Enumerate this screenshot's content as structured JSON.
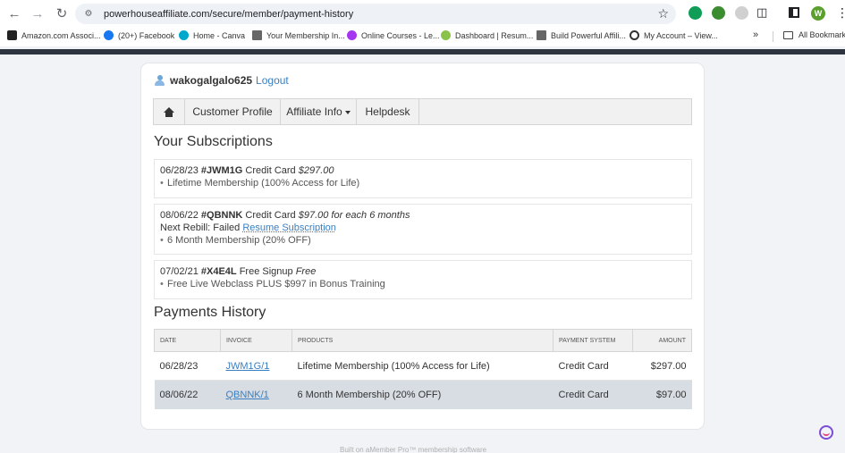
{
  "browser": {
    "url": "powerhouseaffiliate.com/secure/member/payment-history",
    "profile_initial": "W",
    "bookmarks": [
      {
        "label": "Amazon.com Associ...",
        "icon": "amazon-icon",
        "color": "#222222"
      },
      {
        "label": "(20+) Facebook",
        "icon": "facebook-icon",
        "color": "#1877f2"
      },
      {
        "label": "Home - Canva",
        "icon": "canva-icon",
        "color": "#00c4cc"
      },
      {
        "label": "Your Membership In...",
        "icon": "membership-icon",
        "color": "#555555"
      },
      {
        "label": "Online Courses - Le...",
        "icon": "courses-icon",
        "color": "#a435f0"
      },
      {
        "label": "Dashboard | Resum...",
        "icon": "dashboard-icon",
        "color": "#8bc34a"
      },
      {
        "label": "Build Powerful Affili...",
        "icon": "affiliate-icon",
        "color": "#555555"
      },
      {
        "label": "My Account – View...",
        "icon": "account-icon",
        "color": "#333333"
      }
    ],
    "more_label": "»",
    "all_bookmarks_label": "All Bookmarks"
  },
  "user": {
    "name": "wakogalgalo625",
    "logout_label": "Logout"
  },
  "menu": {
    "home_icon": "home-icon",
    "customer_profile": "Customer Profile",
    "affiliate_info": "Affiliate Info",
    "helpdesk": "Helpdesk"
  },
  "subscriptions": {
    "title": "Your Subscriptions",
    "items": [
      {
        "date": "06/28/23",
        "code": "#JWM1G",
        "method": "Credit Card",
        "price": "$297.00",
        "product": "Lifetime Membership (100% Access for Life)"
      },
      {
        "date": "08/06/22",
        "code": "#QBNNK",
        "method": "Credit Card",
        "price": "$97.00 for each 6 months",
        "rebill_label": "Next Rebill: Failed",
        "resume_label": "Resume Subscription",
        "product": "6 Month Membership (20% OFF)"
      },
      {
        "date": "07/02/21",
        "code": "#X4E4L",
        "method": "Free Signup",
        "price": "Free",
        "product": "Free Live Webclass PLUS $997 in Bonus Training"
      }
    ]
  },
  "payments": {
    "title": "Payments History",
    "headers": {
      "date": "DATE",
      "invoice": "INVOICE",
      "products": "PRODUCTS",
      "system": "PAYMENT SYSTEM",
      "amount": "AMOUNT"
    },
    "rows": [
      {
        "date": "06/28/23",
        "invoice": "JWM1G/1",
        "product": "Lifetime Membership (100% Access for Life)",
        "system": "Credit Card",
        "amount": "$297.00"
      },
      {
        "date": "08/06/22",
        "invoice": "QBNNK/1",
        "product": "6 Month Membership (20% OFF)",
        "system": "Credit Card",
        "amount": "$97.00"
      }
    ]
  },
  "footer": {
    "text": "Built on aMember Pro™ membership software"
  }
}
